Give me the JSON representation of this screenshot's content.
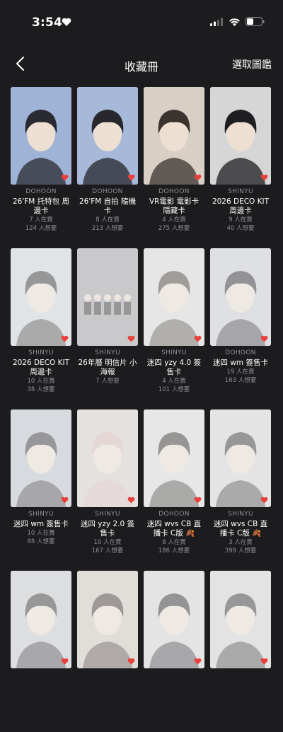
{
  "status_bar": {
    "time": "3:54"
  },
  "nav": {
    "title": "收藏冊",
    "action": "選取圖鑑"
  },
  "colors": {
    "background": "#1c1c1e",
    "heart": "#e8413d",
    "muted": "#8e8e93"
  },
  "cards": [
    {
      "member": "DOHOON",
      "title": "26'FM 托特包 周邊卡",
      "owners": "7 人在賣",
      "wants": "124 人想要",
      "bg": "#9fb3d6",
      "hair": "#2a2a32",
      "dim": false
    },
    {
      "member": "DOHOON",
      "title": "26'FM 自拍 隨機卡",
      "owners": "8 人在賣",
      "wants": "213 人想要",
      "bg": "#a7b9d8",
      "hair": "#26262c",
      "dim": false
    },
    {
      "member": "DOHOON",
      "title": "VR電影 電影卡 隱藏卡",
      "owners": "4 人在賣",
      "wants": "275 人想要",
      "bg": "#d8d0c4",
      "hair": "#3a3330",
      "dim": false
    },
    {
      "member": "SHINYU",
      "title": "2026 DECO KIT 周邊卡",
      "owners": "9 人在賣",
      "wants": "40 人想要",
      "bg": "#d6d6d6",
      "hair": "#1e1e22",
      "dim": false
    },
    {
      "member": "SHINYU",
      "title": "2026 DECO KIT 周邊卡",
      "owners": "10 人在賣",
      "wants": "38 人想要",
      "bg": "#cfd4dc",
      "hair": "#2c2a2a",
      "dim": true
    },
    {
      "member": "SHINYU",
      "title": "26年曆 明信片 小海報",
      "owners": "7 人想要",
      "wants": "",
      "bg": "#9a9aa0",
      "hair": "#444448",
      "dim": true,
      "group": true
    },
    {
      "member": "SHINYU",
      "title": "迷四 yzy 4.0 簽售卡",
      "owners": "4 人在賣",
      "wants": "101 人想要",
      "bg": "#d8dad8",
      "hair": "#3c3530",
      "dim": true
    },
    {
      "member": "DOHOON",
      "title": "迷四 wm 簽售卡",
      "owners": "19 人在賣",
      "wants": "163 人想要",
      "bg": "#c8cdd6",
      "hair": "#232028",
      "dim": true
    },
    {
      "member": "SHINYU",
      "title": "迷四 wm 簽售卡",
      "owners": "10 人在賣",
      "wants": "88 人想要",
      "bg": "#b9bfca",
      "hair": "#2c2a30",
      "dim": true
    },
    {
      "member": "SHINYU",
      "title": "迷四 yzy 2.0 簽售卡",
      "owners": "10 人在賣",
      "wants": "167 人想要",
      "bg": "#d4cfcb",
      "hair": "#d9b8b8",
      "dim": true
    },
    {
      "member": "DOHOON",
      "title": "迷四 wvs CB 直播卡 C版 🍂",
      "owners": "8 人在賣",
      "wants": "186 人想要",
      "bg": "#dcdcdc",
      "hair": "#2a2826",
      "dim": true
    },
    {
      "member": "SHINYU",
      "title": "迷四 wvs CB 直播卡 C版 🍂",
      "owners": "3 人在賣",
      "wants": "399 人想要",
      "bg": "#d6d6d6",
      "hair": "#2a2a2a",
      "dim": true
    },
    {
      "member": "",
      "title": "",
      "owners": "",
      "wants": "",
      "bg": "#c4c7cc",
      "hair": "#2a2a2e",
      "dim": true
    },
    {
      "member": "",
      "title": "",
      "owners": "",
      "wants": "",
      "bg": "#cfc6bd",
      "hair": "#3a302a",
      "dim": true
    },
    {
      "member": "",
      "title": "",
      "owners": "",
      "wants": "",
      "bg": "#d4d6d8",
      "hair": "#242428",
      "dim": true
    },
    {
      "member": "",
      "title": "",
      "owners": "",
      "wants": "",
      "bg": "#d2d2d4",
      "hair": "#2a2a2c",
      "dim": true
    }
  ]
}
